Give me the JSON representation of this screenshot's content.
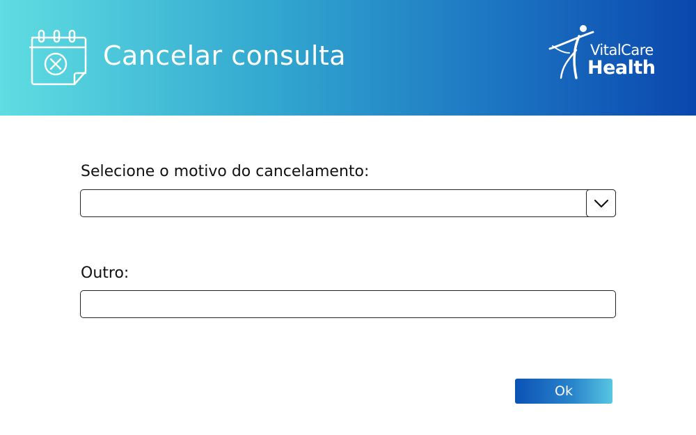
{
  "header": {
    "title": "Cancelar consulta",
    "icon": "calendar-cancel-icon",
    "gradient_colors": [
      "#5fdde2",
      "#31a6cf",
      "#1a6fc0",
      "#0a47ad"
    ]
  },
  "logo": {
    "line1": "VitalCare",
    "line2": "Health",
    "icon": "person-figure-logo"
  },
  "form": {
    "reason_label": "Selecione o motivo do cancelamento:",
    "reason_value": "",
    "reason_dropdown_icon": "chevron-down-icon",
    "other_label": "Outro:",
    "other_value": "",
    "other_placeholder": ""
  },
  "actions": {
    "ok_label": "Ok",
    "ok_colors": [
      "#0b52b5",
      "#58c6e2"
    ]
  }
}
